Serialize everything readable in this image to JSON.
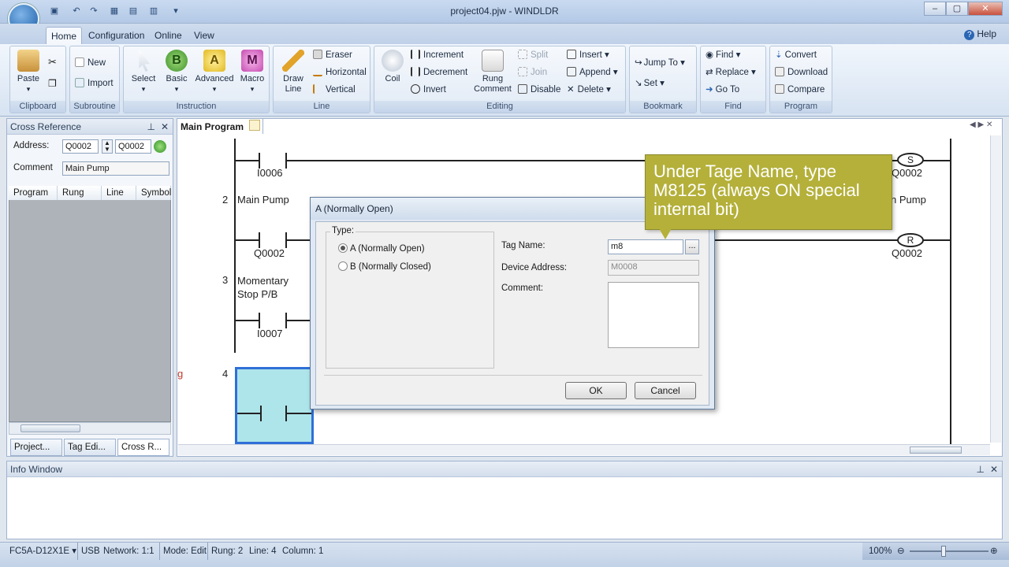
{
  "window": {
    "title": "project04.pjw - WINDLDR"
  },
  "ribbon_tabs": [
    "Home",
    "Configuration",
    "Online",
    "View"
  ],
  "help_label": "Help",
  "ribbon": {
    "clipboard": {
      "paste": "Paste",
      "label": "Clipboard"
    },
    "subroutine": {
      "new": "New",
      "import": "Import",
      "label": "Subroutine"
    },
    "instruction": {
      "select": "Select",
      "basic": "Basic",
      "advanced": "Advanced",
      "macro": "Macro",
      "label": "Instruction"
    },
    "line": {
      "draw_line": "Draw Line",
      "eraser": "Eraser",
      "horizontal": "Horizontal",
      "vertical": "Vertical",
      "label": "Line"
    },
    "editing": {
      "coil": "Coil",
      "increment": "Increment",
      "decrement": "Decrement",
      "invert": "Invert",
      "rung_comment": "Rung Comment",
      "split": "Split",
      "join": "Join",
      "disable": "Disable",
      "insert": "Insert",
      "append": "Append",
      "delete": "Delete",
      "label": "Editing"
    },
    "bookmark": {
      "jump_to": "Jump To",
      "set": "Set",
      "label": "Bookmark"
    },
    "find": {
      "find": "Find",
      "replace": "Replace",
      "go_to": "Go To",
      "label": "Find"
    },
    "program": {
      "convert": "Convert",
      "download": "Download",
      "compare": "Compare",
      "label": "Program"
    }
  },
  "cross_reference": {
    "title": "Cross Reference",
    "address_label": "Address:",
    "address_from": "Q0002",
    "address_to": "Q0002",
    "comment_label": "Comment",
    "comment_value": "Main Pump",
    "columns": [
      "Program",
      "Rung",
      "Line",
      "Symbol"
    ],
    "bottom_tabs": [
      "Project...",
      "Tag Edi...",
      "Cross R..."
    ]
  },
  "editor": {
    "tab": "Main Program",
    "rungs": [
      {
        "num": "",
        "contact": "I0006",
        "coil_type": "S",
        "coil": "Q0002"
      },
      {
        "num": "2",
        "comment": "Main Pump",
        "contact": "Q0002",
        "coil_type": "R",
        "coil": "Q0002",
        "coil_comment": "n Pump"
      },
      {
        "num": "3",
        "comment": "Momentary Stop P/B",
        "contact": "I0007"
      },
      {
        "num": "4"
      }
    ],
    "left_mark": "g"
  },
  "dialog": {
    "title": "A (Normally Open)",
    "type_label": "Type:",
    "options": [
      "A (Normally Open)",
      "B (Normally Closed)"
    ],
    "tag_name_label": "Tag Name:",
    "tag_name_value": "m8",
    "device_address_label": "Device Address:",
    "device_address_value": "M0008",
    "comment_label": "Comment:",
    "browse": "...",
    "ok": "OK",
    "cancel": "Cancel"
  },
  "callout": {
    "text": "Under Tage Name, type M8125 (always ON special internal bit)",
    "color": "#b4b03a"
  },
  "info_window": {
    "title": "Info Window"
  },
  "status": {
    "plc": "FC5A-D12X1E",
    "port": "USB",
    "network": "Network: 1:1",
    "mode": "Mode: Edit",
    "rung": "Rung: 2",
    "line": "Line: 4",
    "column": "Column: 1",
    "zoom": "100%"
  }
}
